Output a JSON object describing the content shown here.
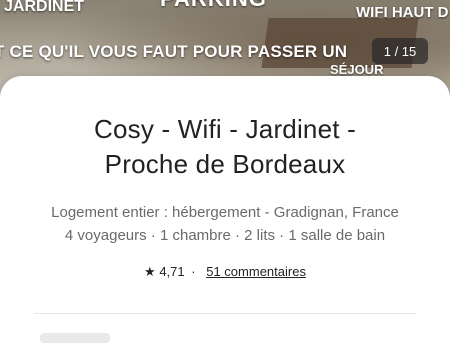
{
  "photo": {
    "overlay_texts": [
      "JARDINET",
      "PARKING",
      "WIFI HAUT D",
      "T CE QU'IL VOUS FAUT POUR PASSER UN",
      "SÉJOUR"
    ],
    "counter": "1 / 15"
  },
  "listing": {
    "title_line1": "Cosy - Wifi - Jardinet -",
    "title_line2": "Proche de Bordeaux",
    "subtitle": "Logement entier : hébergement - Gradignan, France",
    "details": "4 voyageurs · 1 chambre · 2 lits · 1 salle de bain",
    "rating_star": "★",
    "rating": "4,71",
    "dot": "·",
    "reviews": "51 commentaires"
  },
  "icons": {
    "star": "star-icon"
  }
}
